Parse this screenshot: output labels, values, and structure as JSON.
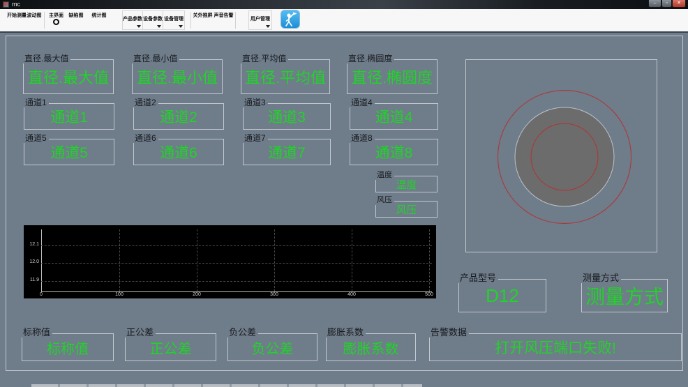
{
  "window": {
    "title": "mc",
    "minimize_glyph": "–",
    "maximize_glyph": "▫",
    "close_glyph": "✕"
  },
  "toolbar": {
    "buttons": [
      {
        "label": "开始测量"
      },
      {
        "label": "波动图"
      },
      {
        "label": "主界面"
      },
      {
        "label": "缺陷图"
      },
      {
        "label": "统计图"
      },
      {
        "label": "产品参数"
      },
      {
        "label": "设备参数"
      },
      {
        "label": "设备管理"
      },
      {
        "label": "关外推屏"
      },
      {
        "label": "声音告警"
      },
      {
        "label": "用户管理"
      }
    ]
  },
  "stats": [
    {
      "title": "直径.最大值",
      "value": "直径.最大值"
    },
    {
      "title": "直径.最小值",
      "value": "直径.最小值"
    },
    {
      "title": "直径.平均值",
      "value": "直径.平均值"
    },
    {
      "title": "直径.椭圆度",
      "value": "直径.椭圆度"
    }
  ],
  "channels": [
    {
      "title": "通道1",
      "value": "通道1"
    },
    {
      "title": "通道2",
      "value": "通道2"
    },
    {
      "title": "通道3",
      "value": "通道3"
    },
    {
      "title": "通道4",
      "value": "通道4"
    },
    {
      "title": "通道5",
      "value": "通道5"
    },
    {
      "title": "通道6",
      "value": "通道6"
    },
    {
      "title": "通道7",
      "value": "通道7"
    },
    {
      "title": "通道8",
      "value": "通道8"
    }
  ],
  "environment": {
    "temperature": {
      "title": "温度",
      "value": "温度"
    },
    "pressure": {
      "title": "风压",
      "value": "风压"
    }
  },
  "trend_chart": {
    "type": "line",
    "series": [],
    "x_ticks": [
      "0",
      "100",
      "200",
      "300",
      "400",
      "500"
    ],
    "y_ticks": [
      "12.1",
      "12.0",
      "11.9"
    ],
    "x_range": [
      0,
      500
    ],
    "y_range": [
      11.85,
      12.15
    ],
    "grid": "dashed",
    "background": "#000000"
  },
  "product_model": {
    "title": "产品型号",
    "value": "D12"
  },
  "measure_mode": {
    "title": "测量方式",
    "value": "测量方式"
  },
  "parameters": [
    {
      "title": "标称值",
      "value": "标称值"
    },
    {
      "title": "正公差",
      "value": "正公差"
    },
    {
      "title": "负公差",
      "value": "负公差"
    },
    {
      "title": "膨胀系数",
      "value": "膨胀系数"
    }
  ],
  "alarm": {
    "title": "告警数据",
    "value": "打开风压端口失败!"
  },
  "colors": {
    "value_green": "#1FD527",
    "client_bg": "#6F7C8A",
    "chart_bg": "#000000",
    "grid_gray": "#4a4a4a",
    "circle_red": "#B23232",
    "circle_gray": "#6C6C6C",
    "close_red": "#C75050"
  }
}
